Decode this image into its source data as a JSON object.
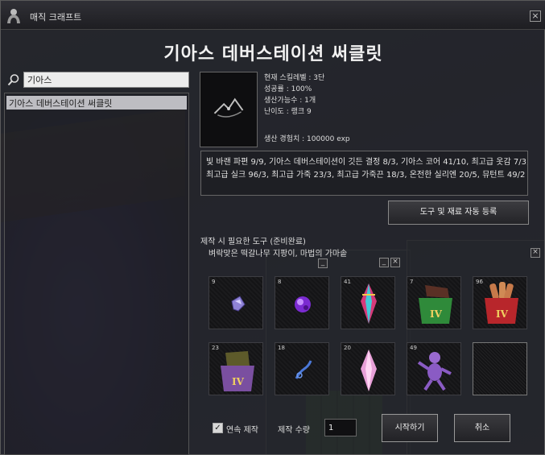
{
  "window": {
    "title": "매직 크래프트",
    "close_label": "×"
  },
  "recipe_title": "기아스 데버스테이션 써클릿",
  "search": {
    "value": "기아스",
    "placeholder": ""
  },
  "recipe_list": [
    {
      "label": "기아스 데버스테이션 써클릿",
      "selected": true
    }
  ],
  "info": {
    "skill_level": "현재 스킬레벨 : 3단",
    "success_rate": "성공률 : 100%",
    "producible": "생산가능수 : 1개",
    "difficulty": "난이도 : 랭크 9",
    "exp": "생산 경험치 : 100000 exp"
  },
  "materials_text": {
    "line1": "빛 바랜 파편 9/9, 기아스 데버스테이션이 깃든 결정 8/3, 기아스 코어 41/10, 최고급 옷감 7/3,",
    "line2": "최고급 실크 96/3, 최고급 가죽 23/3, 최고급 가죽끈 18/3, 온전한 실리엔 20/5, 뮤턴트 49/2"
  },
  "auto_register_button": "도구 및 재료 자동 등록",
  "tools": {
    "title": "제작 시 필요한 도구 (준비완료)",
    "name": "벼락맞은 떡갈나무 지팡이, 마법의 가마솥"
  },
  "slots": [
    {
      "count": "9",
      "icon": "faded-shard-icon"
    },
    {
      "count": "8",
      "icon": "crystal-gem-icon"
    },
    {
      "count": "41",
      "icon": "core-crystal-icon"
    },
    {
      "count": "7",
      "icon": "fabric-bag-icon"
    },
    {
      "count": "96",
      "icon": "silk-bag-icon"
    },
    {
      "count": "23",
      "icon": "leather-bag-icon"
    },
    {
      "count": "18",
      "icon": "leather-strap-icon"
    },
    {
      "count": "20",
      "icon": "silien-crystal-icon"
    },
    {
      "count": "49",
      "icon": "mutant-figure-icon"
    },
    {
      "count": "",
      "icon": "empty-slot"
    }
  ],
  "continuous": {
    "label": "연속 제작",
    "checked": true
  },
  "quantity": {
    "label": "제작 수량",
    "value": "1"
  },
  "start_button": "시작하기",
  "cancel_button": "취소",
  "mini_buttons": {
    "minimize": "_",
    "close": "×"
  },
  "colors": {
    "accent_text": "#f2f2f2",
    "selected_row": "#bdbdc2",
    "bag_green": "#2f8a3a",
    "bag_red": "#b8262b",
    "bag_purple": "#7a4fa0"
  }
}
